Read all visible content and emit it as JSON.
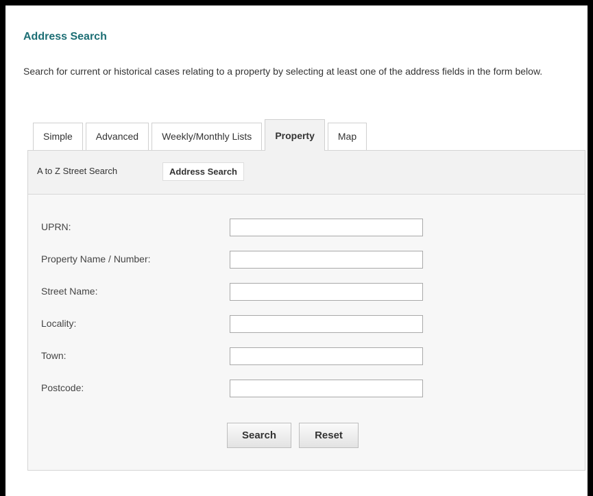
{
  "page": {
    "title": "Address Search",
    "intro": "Search for current or historical cases relating to a property by selecting at least one of the address fields in the form below."
  },
  "tabs": [
    {
      "label": "Simple",
      "active": false
    },
    {
      "label": "Advanced",
      "active": false
    },
    {
      "label": "Weekly/Monthly Lists",
      "active": false
    },
    {
      "label": "Property",
      "active": true
    },
    {
      "label": "Map",
      "active": false
    }
  ],
  "subnav": [
    {
      "label": "A to Z Street Search",
      "active": false
    },
    {
      "label": "Address Search",
      "active": true
    }
  ],
  "form": {
    "fields": [
      {
        "label": "UPRN:",
        "value": ""
      },
      {
        "label": "Property Name / Number:",
        "value": ""
      },
      {
        "label": "Street Name:",
        "value": ""
      },
      {
        "label": "Locality:",
        "value": ""
      },
      {
        "label": "Town:",
        "value": ""
      },
      {
        "label": "Postcode:",
        "value": ""
      }
    ],
    "search_label": "Search",
    "reset_label": "Reset"
  },
  "colors": {
    "title": "#1c6e74",
    "border": "#000000",
    "panel_bg": "#f7f7f7"
  }
}
